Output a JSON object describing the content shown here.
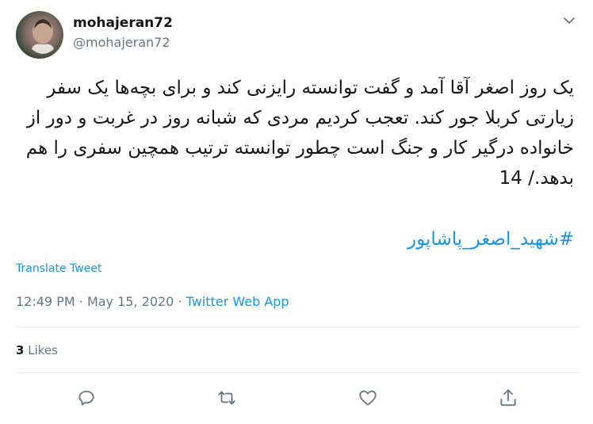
{
  "tweet": {
    "display_name": "mohajeran72",
    "handle": "@mohajeran72",
    "text": "یک روز اصغر آقا آمد و گفت توانسته رایزنی کند و برای بچه‌ها یک سفر زیارتی کربلا جور کند. تعجب کردیم مردی که شبانه روز در غربت و دور از خانواده درگیر کار و جنگ است چطور توانسته ترتیب همچین سفری را هم بدهد./ 14",
    "hashtag": "#شهید_اصغر_پاشاپور",
    "translate_label": "Translate Tweet",
    "time": "12:49 PM",
    "separator": "·",
    "date": "May 15, 2020",
    "app": "Twitter Web App",
    "likes_count": "3",
    "likes_label": "Likes"
  },
  "icons": {
    "menu": "chevron-down-icon",
    "reply": "reply-icon",
    "retweet": "retweet-icon",
    "like": "heart-icon",
    "share": "share-icon"
  },
  "colors": {
    "accent": "#1b95e0",
    "secondary_text": "#657786",
    "primary_text": "#14171a",
    "divider": "#e6ecf0"
  }
}
